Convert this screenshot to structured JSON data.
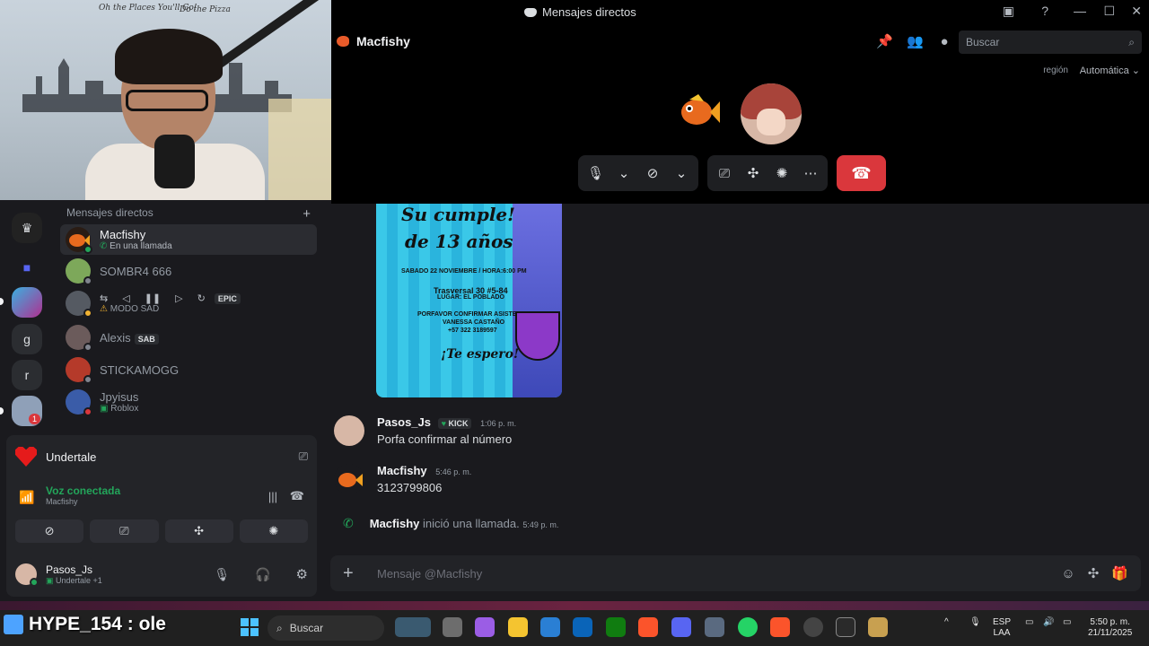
{
  "window": {
    "title": "Mensajes directos"
  },
  "webcam": {
    "scribble_1": "Oh the Places You'll Go!",
    "scribble_2": "Do the Pizza"
  },
  "call": {
    "user": "Macfishy",
    "search_placeholder": "Buscar",
    "region_label": "región",
    "region_value": "Automática"
  },
  "rail": {
    "server_letters": [
      "g",
      "r"
    ],
    "badge": "1"
  },
  "dms": {
    "header": "Mensajes directos",
    "items": [
      {
        "name": "Macfishy",
        "sub": "En una llamada",
        "color": "#e95b2a",
        "status": "#23a55a"
      },
      {
        "name": "SOMBR4 666",
        "sub": "",
        "color": "#7da85a",
        "status": "#80848e"
      },
      {
        "name": "",
        "sub": "MODO SAD",
        "color": "#555a62",
        "status": "#f0b232",
        "media": "EPIC"
      },
      {
        "name": "Alexis",
        "sub": "",
        "color": "#6b5b5b",
        "status": "#80848e",
        "tag": "SAB"
      },
      {
        "name": "STICKAMOGG",
        "sub": "",
        "color": "#b53a2a",
        "status": "#80848e"
      },
      {
        "name": "Jpyisus",
        "sub": "Roblox",
        "color": "#3a5ca8",
        "status": "#da373c"
      }
    ]
  },
  "panel": {
    "game": "Undertale",
    "voice_title": "Voz conectada",
    "voice_sub": "Macfishy",
    "user_name": "Pasos_Js",
    "user_sub": "Undertale +1"
  },
  "invite": {
    "line1": "Su cumple!",
    "line2": "de 13 años",
    "date": "SABADO 22 NOVIEMBRE / HORA:6:00 PM",
    "addr1": "Trasversal 30 #5-84",
    "addr2": "LUGAR: EL POBLADO",
    "confirm": "PORFAVOR CONFIRMAR ASISTENCIA",
    "name": "VANESSA CASTAÑO",
    "phone": "+57 322 3189597",
    "end": "¡Te espero!"
  },
  "messages": [
    {
      "author": "Pasos_Js",
      "badge": "KICK",
      "time": "1:06 p. m.",
      "text": "Porfa confirmar al número"
    },
    {
      "author": "Macfishy",
      "badge": "",
      "time": "5:46 p. m.",
      "text": "3123799806"
    }
  ],
  "system": {
    "author": "Macfishy",
    "text": "inició una llamada.",
    "time": "5:49 p. m."
  },
  "composer": {
    "placeholder": "Mensaje @Macfishy"
  },
  "taskbar": {
    "overlay": "HYPE_154 : ole",
    "search": "Buscar",
    "lang1": "ESP",
    "lang2": "LAA",
    "time": "5:50 p. m.",
    "date": "21/11/2025"
  }
}
